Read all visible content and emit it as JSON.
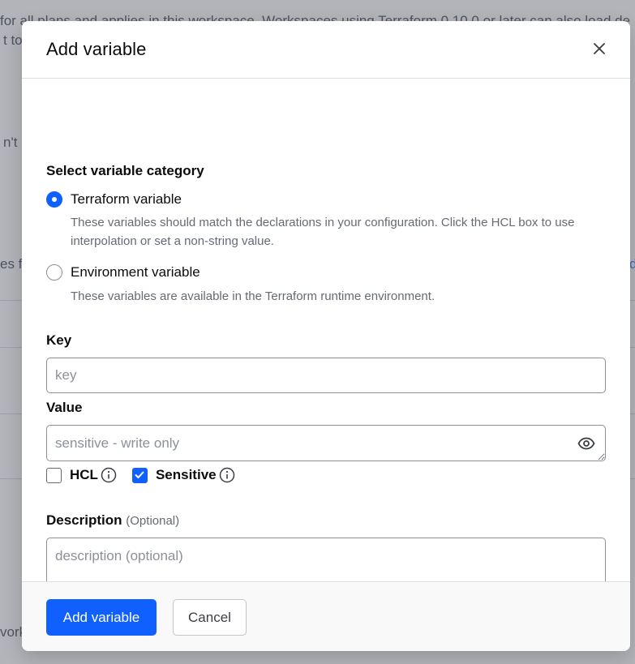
{
  "background": {
    "line1": "for all plans and applies in this workspace. Workspaces using Terraform 0.10.0 or later can also load de",
    "line2": "t to",
    "line3": "n't",
    "line4": "es fr",
    "line5": "vork"
  },
  "modal": {
    "title": "Add variable",
    "close_icon": "close-icon",
    "category": {
      "heading": "Select variable category",
      "options": [
        {
          "label": "Terraform variable",
          "help": "These variables should match the declarations in your configuration. Click the HCL box to use interpolation or set a non-string value.",
          "checked": true
        },
        {
          "label": "Environment variable",
          "help": "These variables are available in the Terraform runtime environment.",
          "checked": false
        }
      ]
    },
    "key": {
      "label": "Key",
      "placeholder": "key",
      "value": ""
    },
    "value": {
      "label": "Value",
      "placeholder": "sensitive - write only",
      "value": "",
      "reveal_icon": "eye-icon"
    },
    "checks": {
      "hcl": {
        "label": "HCL",
        "checked": false
      },
      "sensitive": {
        "label": "Sensitive",
        "checked": true
      }
    },
    "description": {
      "label": "Description",
      "optional": "(Optional)",
      "placeholder": "description (optional)",
      "value": ""
    },
    "footer": {
      "submit_label": "Add variable",
      "cancel_label": "Cancel"
    }
  },
  "colors": {
    "accent": "#1060ff",
    "overlay": "#656a76",
    "text": "#0c0c0e",
    "muted": "#656a76"
  }
}
